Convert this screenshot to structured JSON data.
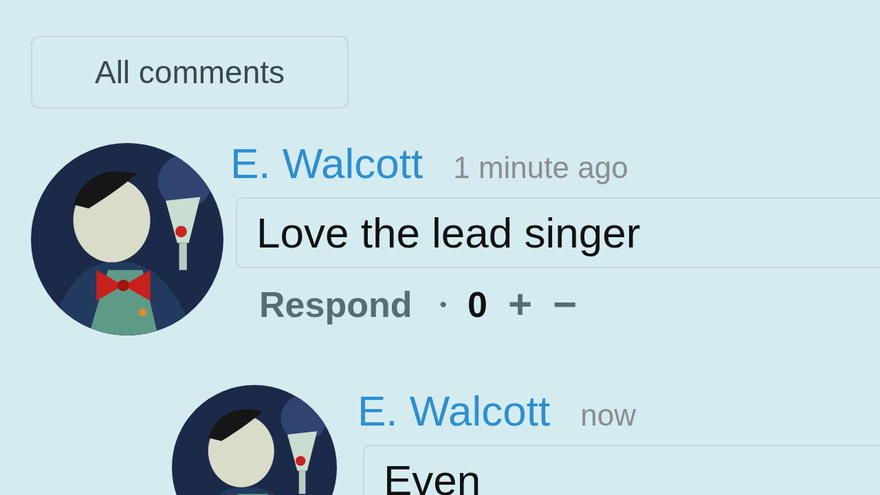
{
  "filter_button": {
    "label": "All comments"
  },
  "comments": [
    {
      "author": "E. Walcott",
      "time": "1 minute ago",
      "text": "Love the lead singer",
      "actions": {
        "respond": "Respond",
        "separator": "•",
        "score": "0",
        "upvote": "+",
        "downvote": "−"
      },
      "replies": [
        {
          "author": "E. Walcott",
          "time": "now",
          "text": "Even"
        }
      ]
    }
  ]
}
